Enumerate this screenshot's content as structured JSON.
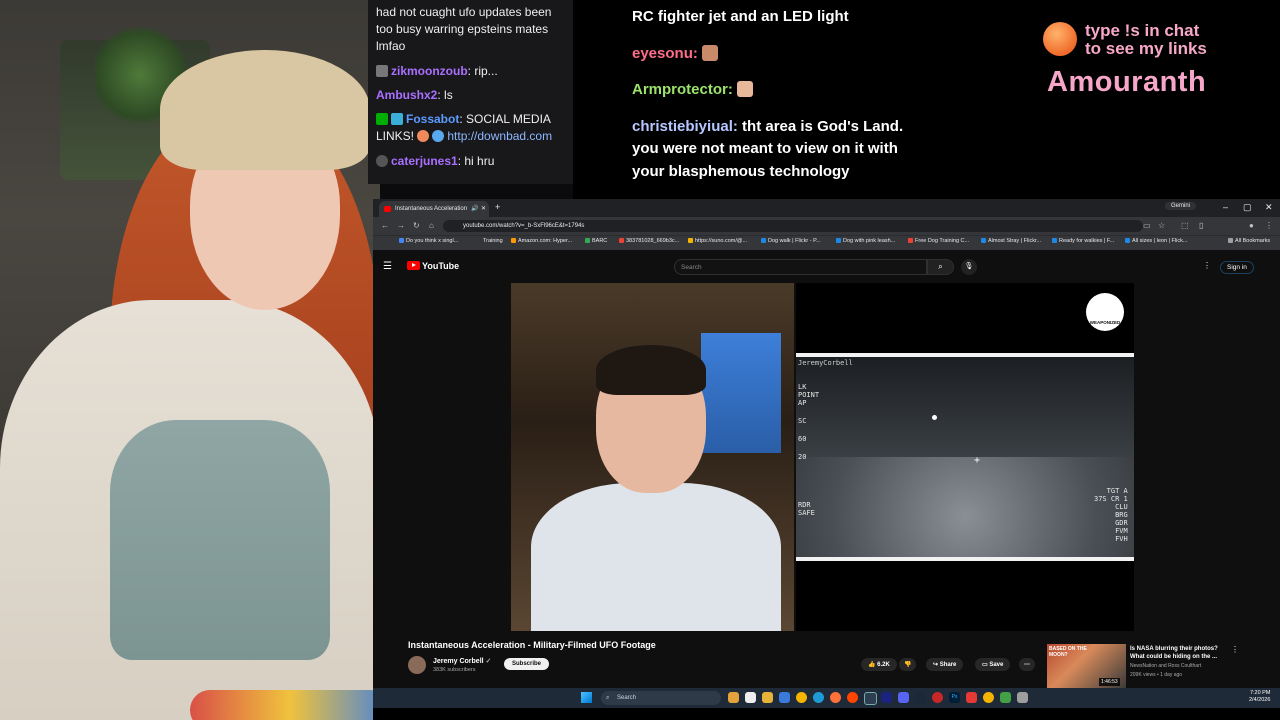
{
  "chat_left": {
    "messages": [
      {
        "text": "had not cuaght ufo updates been"
      },
      {
        "text": "too busy warring epsteins mates"
      },
      {
        "text": "lmfao"
      },
      {
        "user": "zikmoonzoub",
        "text": ": rip..."
      },
      {
        "user": "Ambushx2",
        "text": ": ls"
      },
      {
        "user": "Fossabot",
        "text": ": SOCIAL MEDIA"
      },
      {
        "text": "LINKS!",
        "link": "http://downbad.com"
      },
      {
        "user": "caterjunes1",
        "text": ": hi hru"
      }
    ]
  },
  "chat_center": {
    "line1": "RC fighter jet and an LED light",
    "user1": "eyesonu:",
    "user2": "Armprotector:",
    "user3": "christiebiyiual:",
    "msg3a": " tht area is God's Land.",
    "msg3b": "you were not meant to view on it with",
    "msg3c": "your blasphemous technology"
  },
  "promo": {
    "line1": "type !s in chat",
    "line2": "to see my links",
    "name": "Amouranth"
  },
  "browser": {
    "tab_title": "Instantaneous Acceleration",
    "gemini": "Gemini",
    "url": "youtube.com/watch?v=_b-SxFl96cE&t=1794s",
    "bookmarks": [
      "Do you think x singl...",
      "Training",
      "Amazon.com: Hyper...",
      "BARC",
      "383781028_669b3c...",
      "https://suno.com/@...",
      "Dog walk | Flickr - P...",
      "Dog with pink leash...",
      "Free Dog Training C...",
      "Almost Stray | Flickr...",
      "Ready for walkies | F...",
      "All sizes | leon | Flick...",
      "All Bookmarks"
    ],
    "bookmark_colors": [
      "#4285f4",
      "#9aa0a6",
      "#ff9900",
      "#34a853",
      "#ea4335",
      "#f4b400",
      "#1e88e5",
      "#1e88e5",
      "#ea4335",
      "#1e88e5",
      "#1e88e5",
      "#1e88e5",
      "#9aa0a6"
    ]
  },
  "youtube": {
    "logo": "YouTube",
    "search_placeholder": "Search",
    "signin": "Sign in",
    "video_title": "Instantaneous Acceleration - Military-Filmed UFO Footage",
    "channel": "Jeremy Corbell",
    "subscribers": "383K subscribers",
    "subscribe": "Subscribe",
    "likes": "6.2K",
    "share": "Share",
    "save": "Save",
    "flir_watermark": "JeremyCorbell",
    "flir_left": [
      "LK",
      "POINT",
      "AP",
      "SC",
      "60",
      "20",
      "RDR",
      "SAFE"
    ],
    "flir_right": [
      "TGT A",
      "37S CR 1",
      "CLU",
      "BRG",
      "GDR",
      "FVM",
      "FVH"
    ],
    "weaponized": "WEAPONIZED",
    "recommended": {
      "title": "Is NASA blurring their photos? What could be hiding on the ...",
      "channel": "NewsNation and Ross Coulthart",
      "meta": "209K views • 1 day ago",
      "duration": "1:46:53",
      "thumb_text": "BASED ON THE MOON?"
    }
  },
  "taskbar": {
    "search": "Search",
    "time": "7:20 PM",
    "date": "2/4/2026"
  }
}
